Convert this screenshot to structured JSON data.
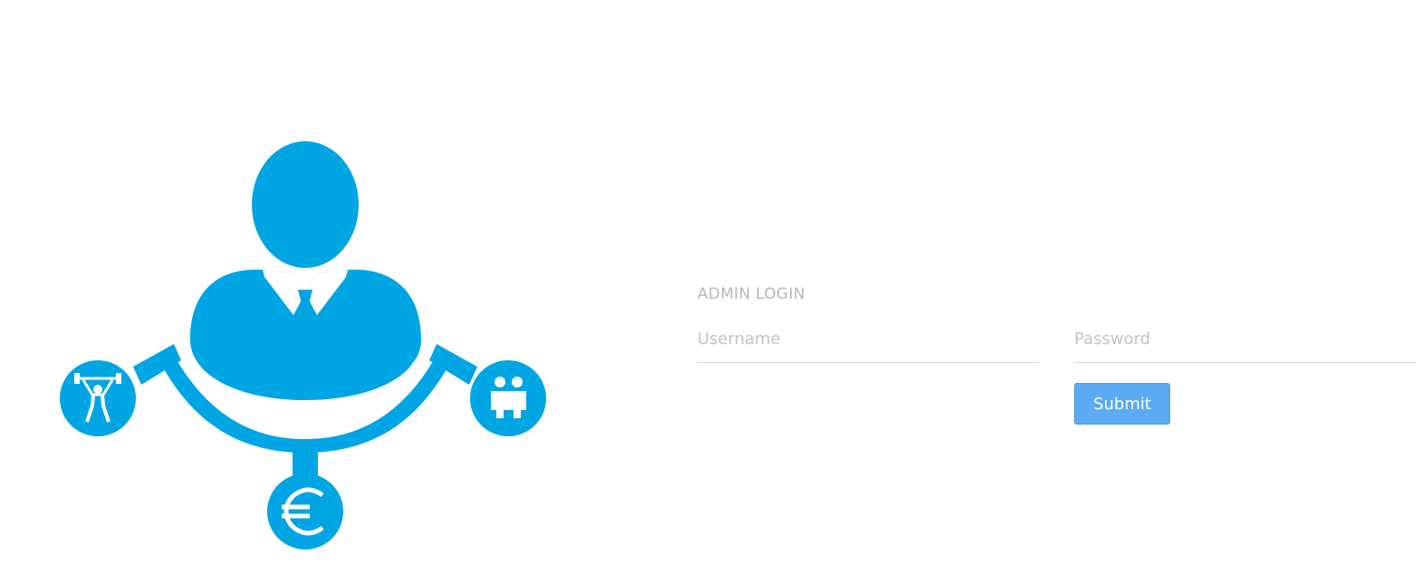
{
  "login": {
    "title": "ADMIN LOGIN",
    "username_placeholder": "Username",
    "password_placeholder": "Password",
    "submit_label": "Submit"
  },
  "colors": {
    "brand": "#00a5e3",
    "button": "#5aabf3",
    "placeholder": "#c4c4c4"
  },
  "icons": {
    "logo": "person-network-logo",
    "left": "weightlifter-icon",
    "right": "two-people-icon",
    "bottom": "euro-icon"
  }
}
